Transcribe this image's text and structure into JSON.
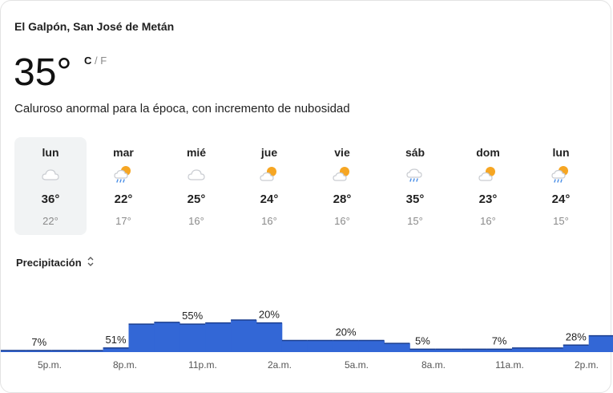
{
  "location": "El Galpón, San José de Metán",
  "current": {
    "temperature": "35°",
    "unit_c": "C",
    "unit_sep": "/",
    "unit_f": "F",
    "description": "Caluroso anormal para la época, con incremento de nubosidad"
  },
  "forecast": [
    {
      "day": "lun",
      "high": "36°",
      "low": "22°",
      "icon": "cloudy-icon",
      "selected": true
    },
    {
      "day": "mar",
      "high": "22°",
      "low": "17°",
      "icon": "sun-cloud-rain-icon"
    },
    {
      "day": "mié",
      "high": "25°",
      "low": "16°",
      "icon": "cloudy-icon"
    },
    {
      "day": "jue",
      "high": "24°",
      "low": "16°",
      "icon": "partly-cloudy-icon"
    },
    {
      "day": "vie",
      "high": "28°",
      "low": "16°",
      "icon": "partly-cloudy-icon"
    },
    {
      "day": "sáb",
      "high": "35°",
      "low": "15°",
      "icon": "cloud-rain-icon"
    },
    {
      "day": "dom",
      "high": "23°",
      "low": "16°",
      "icon": "partly-cloudy-icon"
    },
    {
      "day": "lun",
      "high": "24°",
      "low": "15°",
      "icon": "sun-cloud-rain-icon"
    }
  ],
  "precipitation": {
    "label": "Precipitación",
    "chevron_icon": "up-down-chevron-icon"
  },
  "chart_data": {
    "type": "bar",
    "values": [
      2,
      2,
      2,
      2,
      7,
      48,
      51,
      48,
      50,
      55,
      50,
      20,
      20,
      20,
      20,
      15,
      5,
      5,
      5,
      5,
      7,
      7,
      12,
      28,
      28,
      35
    ],
    "labels": {
      "1": "7%",
      "4": "51%",
      "7": "55%",
      "10": "20%",
      "13": "20%",
      "16": "5%",
      "19": "7%",
      "22": "28%"
    },
    "x_ticks": [
      "5p.m.",
      "8p.m.",
      "11p.m.",
      "2a.m.",
      "5a.m.",
      "8a.m.",
      "11a.m.",
      "2p.m."
    ],
    "ylim": [
      0,
      100
    ],
    "bar_color": "#3367d6",
    "baseline_color": "#1c3f8f"
  }
}
